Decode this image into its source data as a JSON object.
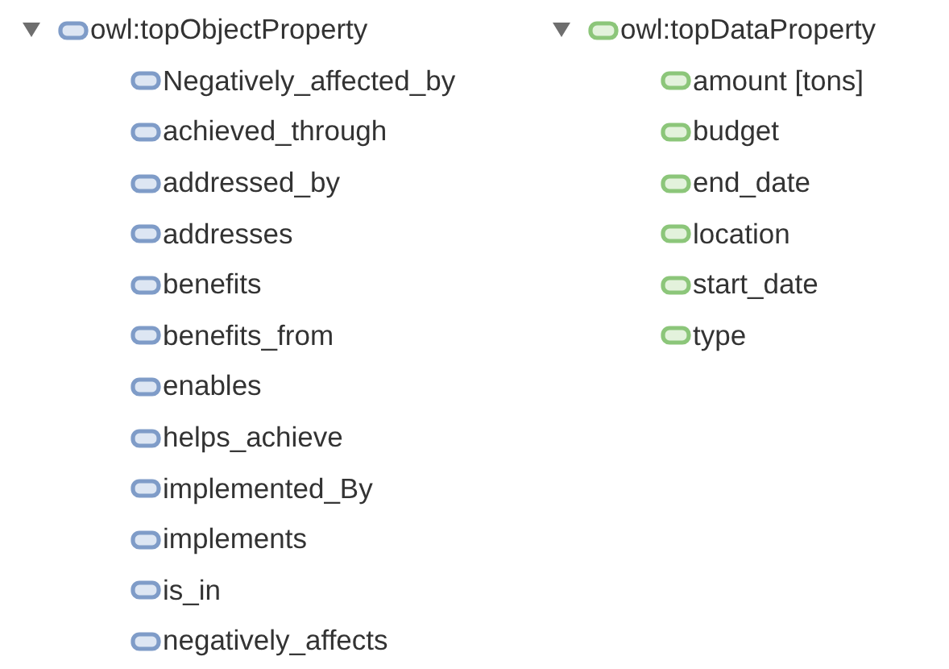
{
  "trees": [
    {
      "label": "owl:topObjectProperty",
      "kind": "object",
      "expanded": true,
      "children": [
        {
          "label": "Negatively_affected_by"
        },
        {
          "label": "achieved_through"
        },
        {
          "label": "addressed_by"
        },
        {
          "label": "addresses"
        },
        {
          "label": "benefits"
        },
        {
          "label": "benefits_from"
        },
        {
          "label": "enables"
        },
        {
          "label": "helps_achieve"
        },
        {
          "label": "implemented_By"
        },
        {
          "label": "implements"
        },
        {
          "label": "is_in"
        },
        {
          "label": "negatively_affects"
        }
      ]
    },
    {
      "label": "owl:topDataProperty",
      "kind": "data",
      "expanded": true,
      "children": [
        {
          "label": "amount [tons]"
        },
        {
          "label": "budget"
        },
        {
          "label": "end_date"
        },
        {
          "label": "location"
        },
        {
          "label": "start_date"
        },
        {
          "label": "type"
        }
      ]
    }
  ]
}
